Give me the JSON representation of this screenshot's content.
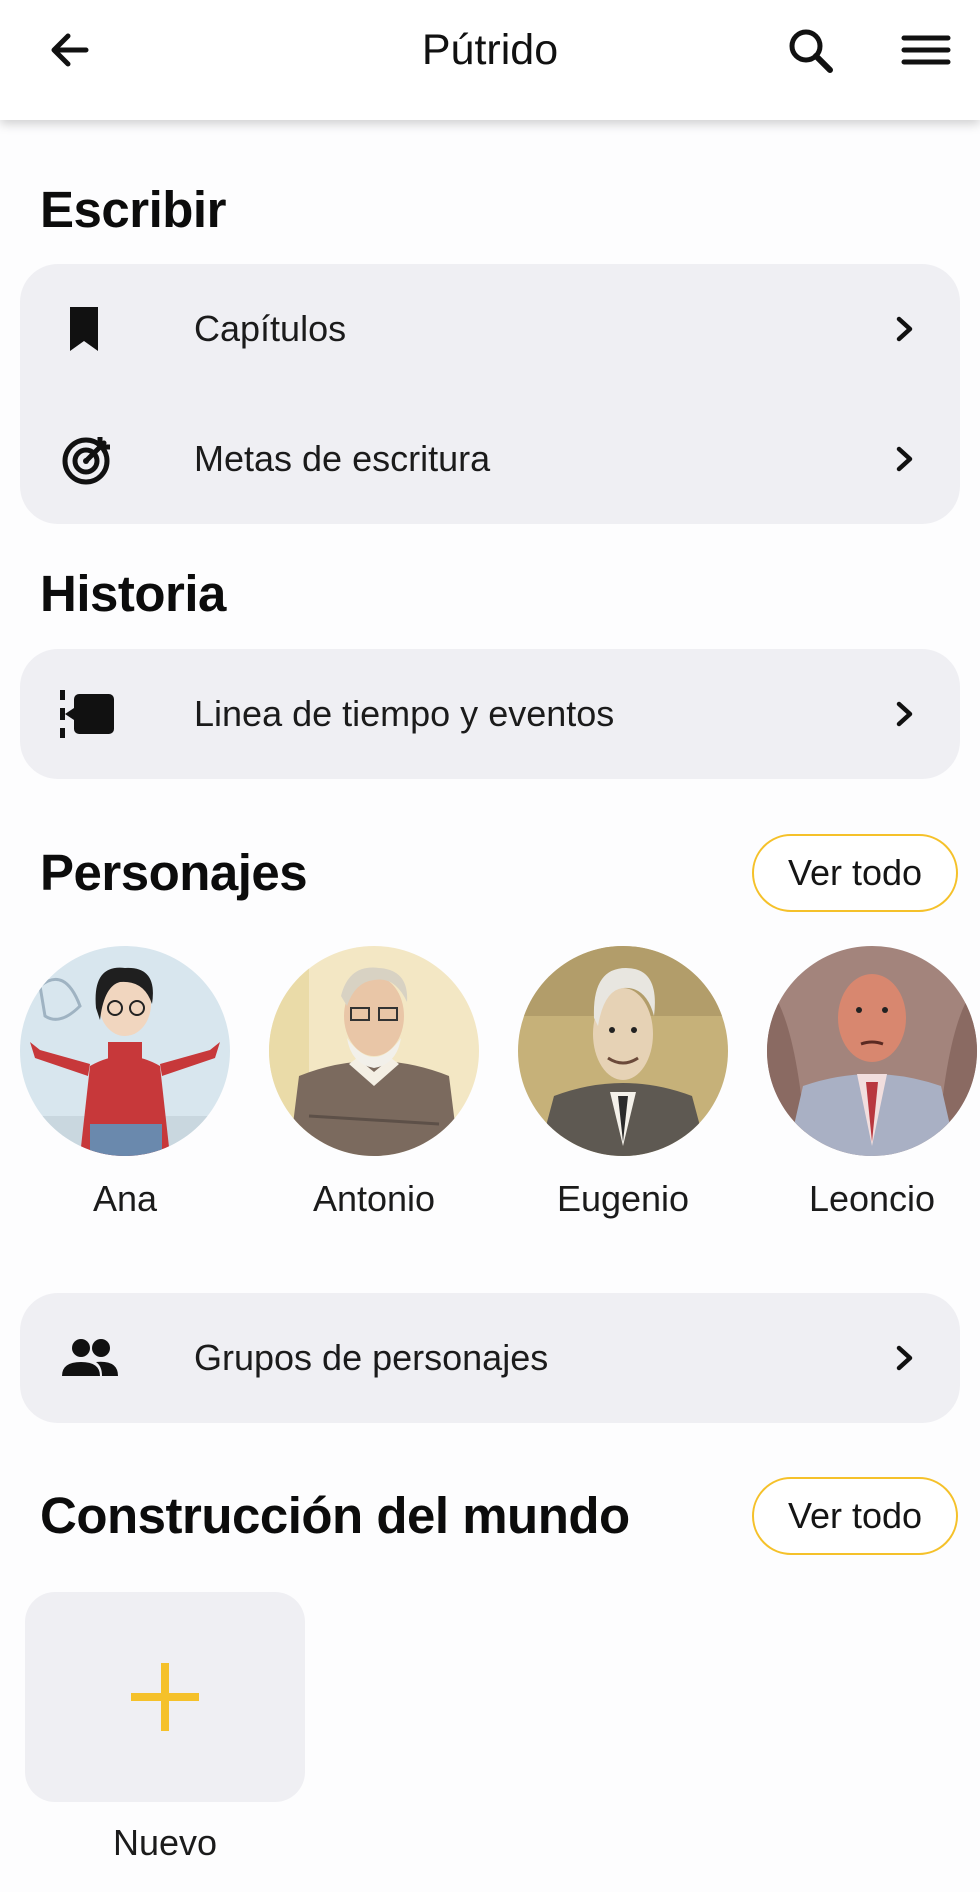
{
  "header": {
    "title": "Pútrido",
    "back_icon": "arrow-left-icon",
    "search_icon": "search-icon",
    "menu_icon": "hamburger-menu-icon"
  },
  "colors": {
    "accent": "#F5C12A",
    "card": "#EFEFF3",
    "background": "#FDFDFE"
  },
  "write": {
    "title": "Escribir",
    "items": [
      {
        "label": "Capítulos",
        "icon": "bookmark-icon"
      },
      {
        "label": "Metas de escritura",
        "icon": "target-icon"
      }
    ]
  },
  "story": {
    "title": "Historia",
    "items": [
      {
        "label": "Linea de tiempo y eventos",
        "icon": "timeline-icon"
      }
    ]
  },
  "characters": {
    "title": "Personajes",
    "see_all": "Ver todo",
    "list": [
      {
        "name": "Ana"
      },
      {
        "name": "Antonio"
      },
      {
        "name": "Eugenio"
      },
      {
        "name": "Leoncio"
      }
    ],
    "groups_label": "Grupos de personajes",
    "groups_icon": "people-icon"
  },
  "worldbuilding": {
    "title": "Construcción del mundo",
    "see_all": "Ver todo",
    "new_label": "Nuevo",
    "new_icon": "plus-icon"
  }
}
